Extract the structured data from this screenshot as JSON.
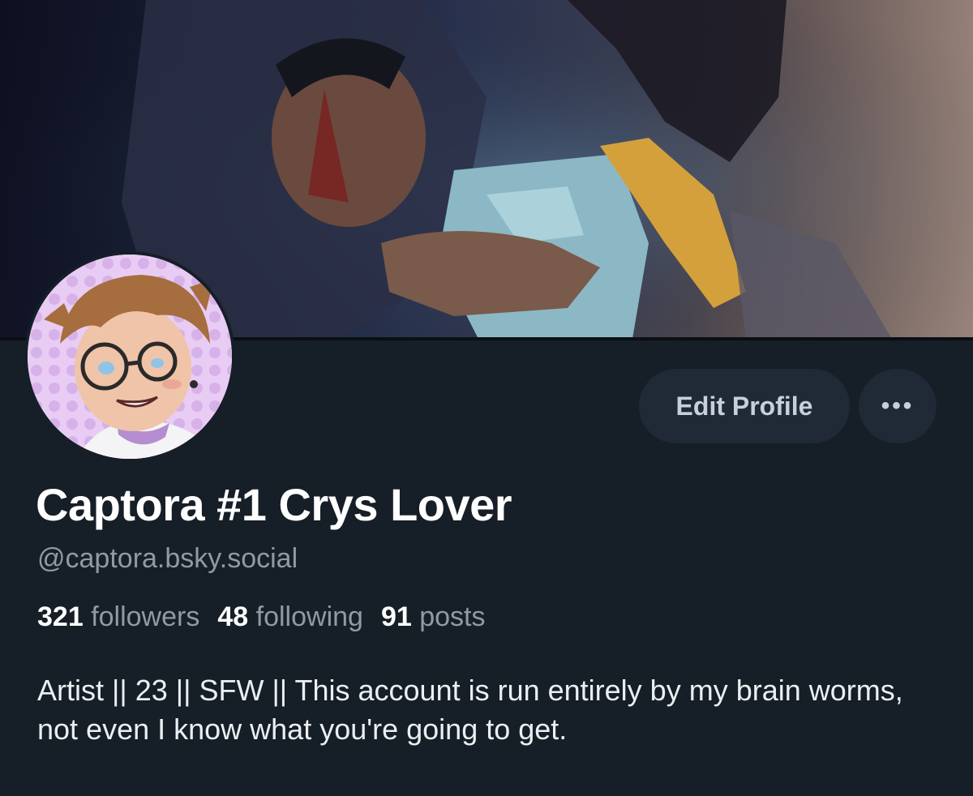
{
  "profile": {
    "display_name": "Captora #1 Crys Lover",
    "handle": "@captora.bsky.social",
    "bio": "Artist || 23 || SFW || This account is run entirely by my brain worms, not even I know what you're going to get."
  },
  "stats": {
    "followers_count": "321",
    "followers_label": "followers",
    "following_count": "48",
    "following_label": "following",
    "posts_count": "91",
    "posts_label": "posts"
  },
  "actions": {
    "edit_profile_label": "Edit Profile",
    "more_label": "•••"
  },
  "icons": {
    "more": "ellipsis-icon"
  },
  "colors": {
    "background": "#161e27",
    "button_bg": "#1f2a36",
    "muted_text": "#8f9aa6"
  }
}
